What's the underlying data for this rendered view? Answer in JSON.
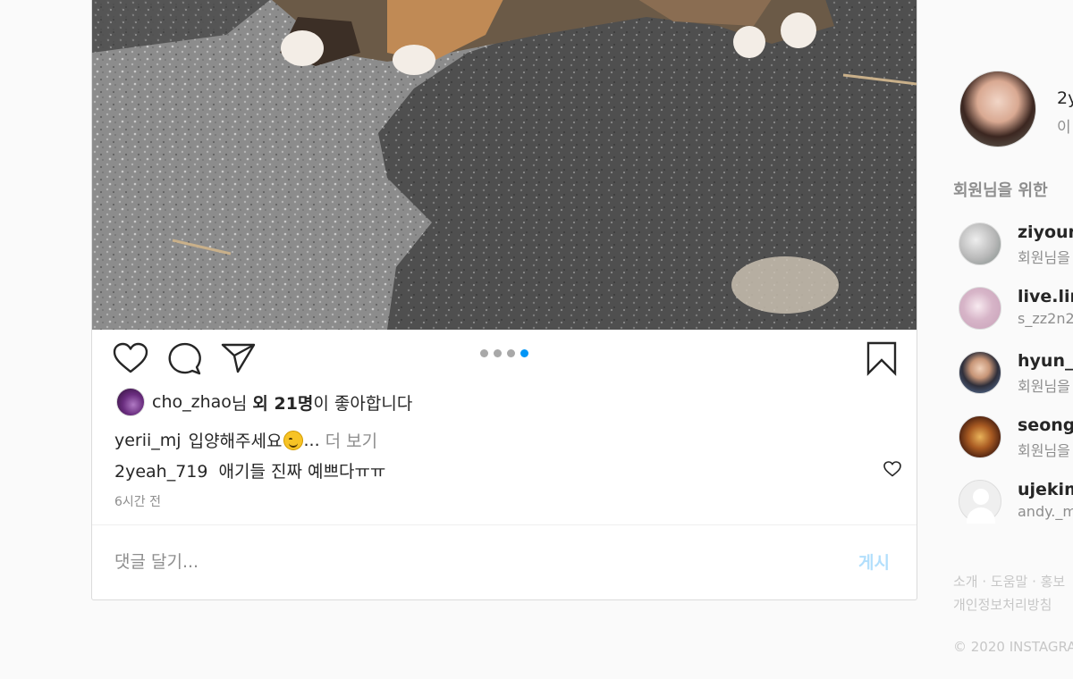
{
  "post": {
    "carousel": {
      "total": 4,
      "active_index": 3
    },
    "likes": {
      "liker": "cho_zhao",
      "liker_suffix": "님",
      "others": "외 21명",
      "tail": "이 좋아합니다"
    },
    "caption": {
      "user": "yerii_mj",
      "text": "입양해주세요",
      "ellipsis": "...",
      "more": "더 보기"
    },
    "comment": {
      "user": "2yeah_719",
      "text": "애기들 진짜 예쁘다ㅠㅠ"
    },
    "timestamp": "6시간 전",
    "comment_input": {
      "placeholder": "댓글 달기..."
    },
    "post_button": "게시",
    "colors": {
      "accent": "#0095f6",
      "post_disabled": "#b2dffc",
      "muted": "#8e8e8e"
    }
  },
  "sidebar": {
    "me": {
      "username": "2y",
      "name": "이"
    },
    "suggestions_title": "회원님을 위한",
    "suggestions": [
      {
        "username": "ziyoun",
        "subtitle": "회원님을"
      },
      {
        "username": "live.lim",
        "subtitle": "s_zz2n2_"
      },
      {
        "username": "hyun_c",
        "subtitle": "회원님을"
      },
      {
        "username": "seongr",
        "subtitle": "회원님을"
      },
      {
        "username": "ujekim",
        "subtitle": "andy._m"
      }
    ],
    "footer": {
      "line1": "소개 · 도움말 · 홍보",
      "line2": "개인정보처리방침",
      "copyright": "© 2020 INSTAGRA"
    }
  }
}
